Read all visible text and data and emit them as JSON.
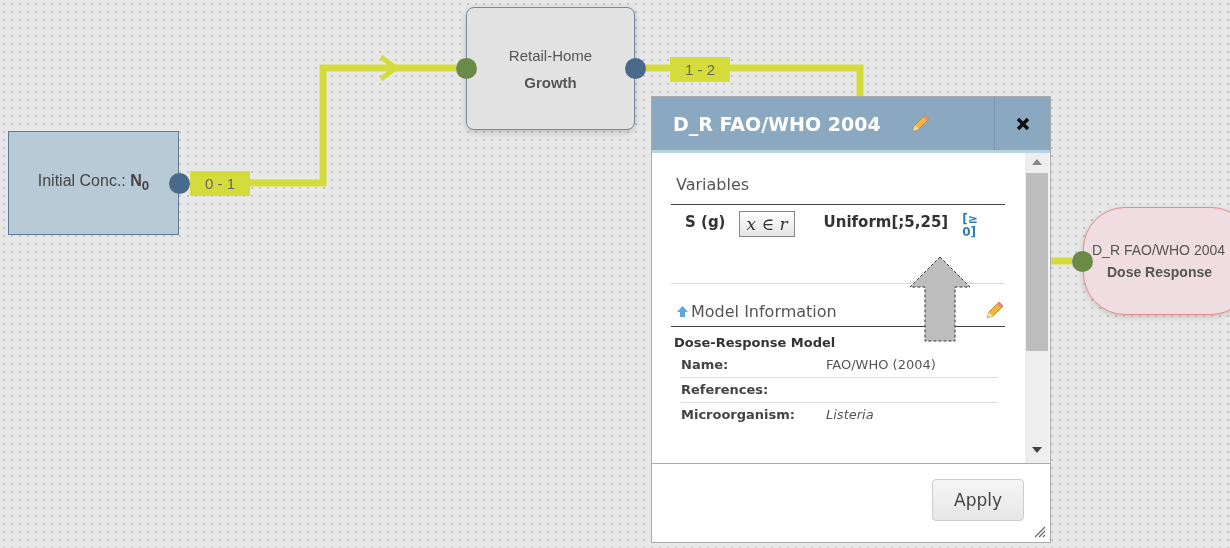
{
  "nodes": [
    {
      "kind": "start",
      "label": "Initial Conc.: **N**$_{0}$",
      "ports": [
        {
          "color": "#4a6a8c"
        }
      ]
    },
    {
      "kind": "process",
      "label": "Retail-Home",
      "sublabel": "Growth",
      "ports": [
        {
          "color": "#6a8a45"
        },
        {
          "color": "#4a6a8c"
        }
      ]
    },
    {
      "kind": "response",
      "label": "D_R FAO/WHO 2004",
      "sublabel": "Dose Response",
      "ports": [
        {
          "color": "#6a8a45"
        }
      ]
    }
  ],
  "connectors": [
    {
      "label": "0 - 1"
    },
    {
      "label": "1 - 2"
    }
  ],
  "dialog": {
    "title": "D_R FAO/WHO 2004",
    "variables": {
      "heading": "Variables",
      "rows": [
        {
          "name": "S (g)",
          "input_button": "x ∈ r",
          "value": "Uniform[;5,25]",
          "constraint": "[≥0]"
        }
      ]
    },
    "model_information": {
      "heading": "Model Information",
      "expanded": true,
      "subheading": "Dose-Response Model",
      "fields": [
        {
          "label": "Name:",
          "value": "FAO/WHO (2004)"
        },
        {
          "label": "References:"
        },
        {
          "label": "Microorganism:",
          "value": "Listeria"
        }
      ]
    },
    "apply_button": "Apply"
  }
}
